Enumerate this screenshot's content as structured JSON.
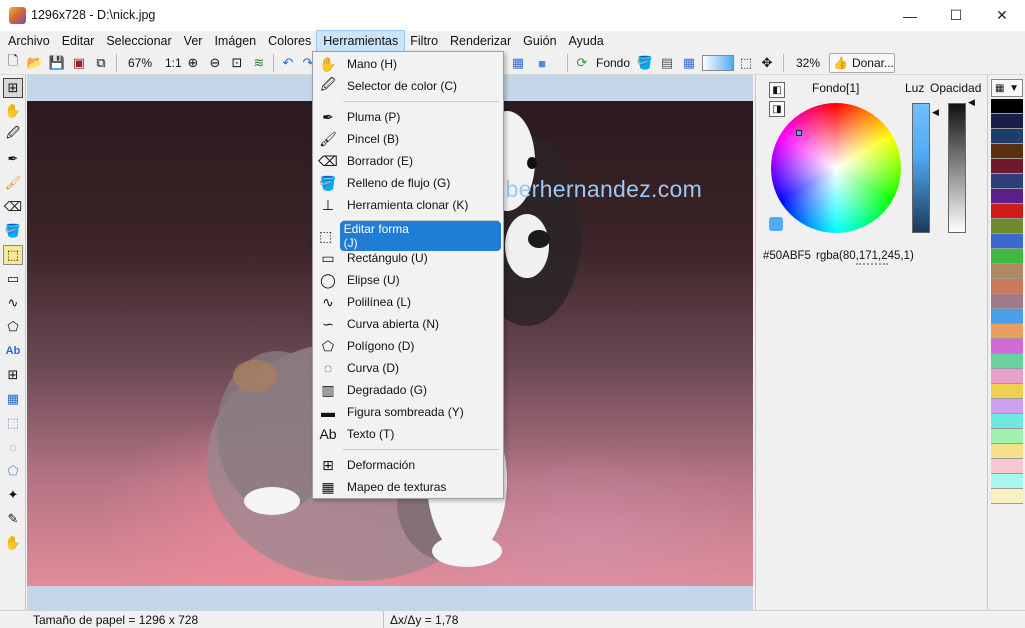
{
  "window": {
    "title": "1296x728 - D:\\nick.jpg",
    "controls": [
      "—",
      "☐",
      "✕"
    ]
  },
  "menubar": [
    "Archivo",
    "Editar",
    "Seleccionar",
    "Ver",
    "Imágen",
    "Colores",
    "Herramientas",
    "Filtro",
    "Renderizar",
    "Guión",
    "Ayuda"
  ],
  "toolbar": {
    "zoom": "67%",
    "one_to_one": "1:1",
    "fondo_label": "Fondo",
    "right_zoom": "32%",
    "donate_label": "Donar..."
  },
  "dropdown": [
    {
      "label": "Mano (H)",
      "icon": "hand-icon",
      "glyph": "✋"
    },
    {
      "label": "Selector de color (C)",
      "icon": "eyedropper-icon",
      "glyph": "🖉"
    },
    {
      "label": "Pluma (P)",
      "icon": "pen-icon",
      "glyph": "✒"
    },
    {
      "label": "Pincel (B)",
      "icon": "brush-icon",
      "glyph": "🖌"
    },
    {
      "label": "Borrador (E)",
      "icon": "eraser-icon",
      "glyph": "⌫"
    },
    {
      "label": "Relleno de flujo (G)",
      "icon": "bucket-icon",
      "glyph": "🪣"
    },
    {
      "label": "Herramienta clonar (K)",
      "icon": "stamp-icon",
      "glyph": "⊥"
    },
    {
      "label": "Editar forma (J)",
      "icon": "edit-shape-icon",
      "glyph": "⬚"
    },
    {
      "label": "Rectángulo (U)",
      "icon": "rectangle-icon",
      "glyph": "▭"
    },
    {
      "label": "Elipse (U)",
      "icon": "ellipse-icon",
      "glyph": "◯"
    },
    {
      "label": "Polilínea (L)",
      "icon": "polyline-icon",
      "glyph": "∿"
    },
    {
      "label": "Curva abierta (N)",
      "icon": "open-curve-icon",
      "glyph": "∽"
    },
    {
      "label": "Polígono (D)",
      "icon": "polygon-icon",
      "glyph": "⬠"
    },
    {
      "label": "Curva (D)",
      "icon": "curve-icon",
      "glyph": "◌"
    },
    {
      "label": "Degradado (G)",
      "icon": "gradient-icon",
      "glyph": "▥"
    },
    {
      "label": "Figura sombreada (Y)",
      "icon": "shaded-shape-icon",
      "glyph": "▬"
    },
    {
      "label": "Texto (T)",
      "icon": "text-icon",
      "glyph": "Ab"
    },
    {
      "label": "Deformación",
      "icon": "deform-icon",
      "glyph": "⊞"
    },
    {
      "label": "Mapeo de texturas",
      "icon": "texture-map-icon",
      "glyph": "▦"
    }
  ],
  "canvas": {
    "watermark": "hiberhernandez.com"
  },
  "color_panel": {
    "fondo_label": "Fondo[1]",
    "luz_label": "Luz",
    "opacity_label": "Opacidad",
    "hex": "#50ABF5",
    "rgba": "rgba(80,171,245,1)",
    "current_color": "#50ABF5"
  },
  "swatches": [
    "#000000",
    "#1a1f4a",
    "#1c3f6e",
    "#5a2f10",
    "#6e1a2a",
    "#2c3f7a",
    "#5a1f8a",
    "#d01a1a",
    "#6e8a2a",
    "#3a6ad0",
    "#3fb83f",
    "#b08a60",
    "#c87a5a",
    "#a07a8a",
    "#4aa0e8",
    "#e8a060",
    "#d26ad8",
    "#6ad0a0",
    "#e8a0c8",
    "#f0d050",
    "#d0a0f0",
    "#70e8e0",
    "#a0f0b0",
    "#f8e08a",
    "#f8c8d0",
    "#a8f8f0",
    "#f8f0c0"
  ],
  "status": {
    "paper_size": "Tamaño de papel = 1296 x 728",
    "delta": "Δx/Δy = 1,78"
  }
}
